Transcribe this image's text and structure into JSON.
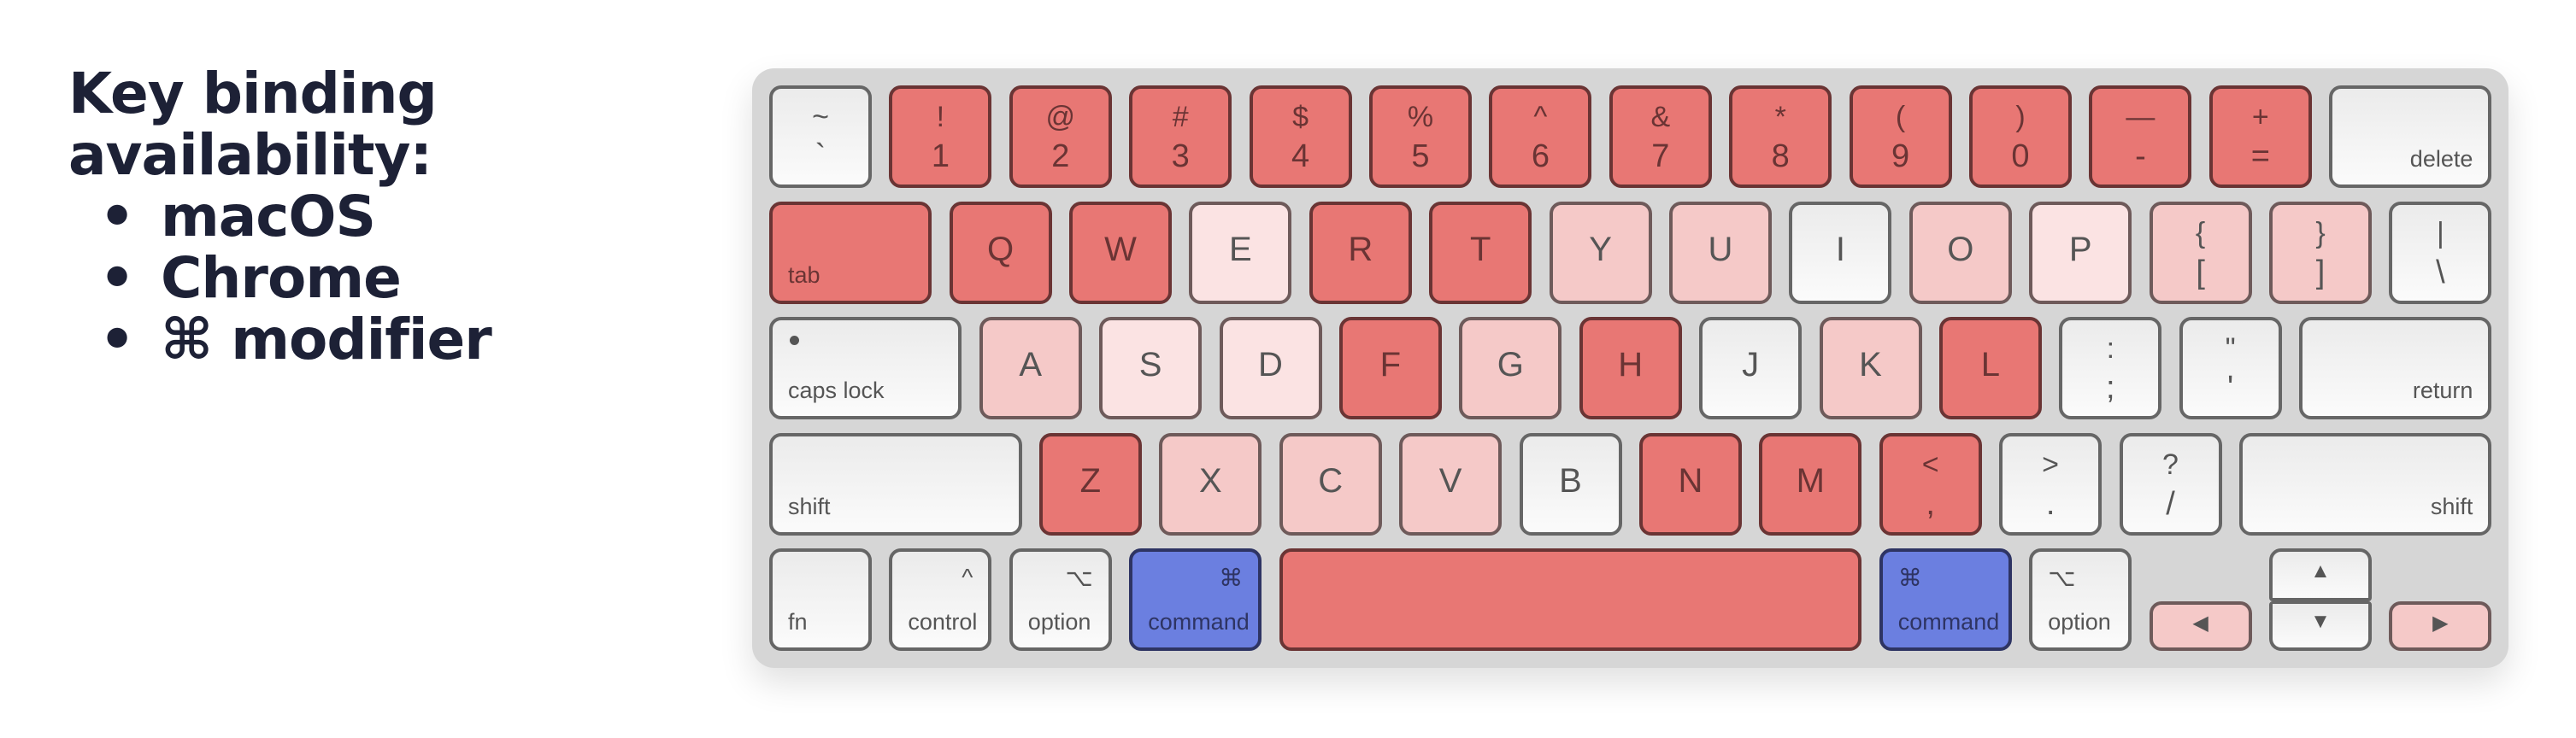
{
  "title": {
    "heading_line1": "Key binding",
    "heading_line2": "availability:",
    "bullet_glyph": "•",
    "items": [
      "macOS",
      "Chrome",
      "⌘ modifier"
    ]
  },
  "legend_colors": {
    "unavailable": "#e87774",
    "mostly_unavailable": "#f5c9c8",
    "partly_unavailable": "#fbe3e3",
    "available": "#f5f5f5",
    "modifier": "#6b7fe0"
  },
  "keyboard": {
    "rows": [
      [
        {
          "id": "backtick",
          "top": "~",
          "bottom": "`",
          "shade": "none"
        },
        {
          "id": "1",
          "top": "!",
          "bottom": "1",
          "shade": "full"
        },
        {
          "id": "2",
          "top": "@",
          "bottom": "2",
          "shade": "full"
        },
        {
          "id": "3",
          "top": "#",
          "bottom": "3",
          "shade": "full"
        },
        {
          "id": "4",
          "top": "$",
          "bottom": "4",
          "shade": "full"
        },
        {
          "id": "5",
          "top": "%",
          "bottom": "5",
          "shade": "full"
        },
        {
          "id": "6",
          "top": "^",
          "bottom": "6",
          "shade": "full"
        },
        {
          "id": "7",
          "top": "&",
          "bottom": "7",
          "shade": "full"
        },
        {
          "id": "8",
          "top": "*",
          "bottom": "8",
          "shade": "full"
        },
        {
          "id": "9",
          "top": "(",
          "bottom": "9",
          "shade": "full"
        },
        {
          "id": "0",
          "top": ")",
          "bottom": "0",
          "shade": "full"
        },
        {
          "id": "minus",
          "top": "—",
          "bottom": "-",
          "shade": "full"
        },
        {
          "id": "equals",
          "top": "+",
          "bottom": "=",
          "shade": "full"
        },
        {
          "id": "delete",
          "label": "delete",
          "shade": "none"
        }
      ],
      [
        {
          "id": "tab",
          "label": "tab",
          "shade": "full"
        },
        {
          "id": "q",
          "center": "Q",
          "shade": "full"
        },
        {
          "id": "w",
          "center": "W",
          "shade": "full"
        },
        {
          "id": "e",
          "center": "E",
          "shade": "light"
        },
        {
          "id": "r",
          "center": "R",
          "shade": "full"
        },
        {
          "id": "t",
          "center": "T",
          "shade": "full"
        },
        {
          "id": "y",
          "center": "Y",
          "shade": "med"
        },
        {
          "id": "u",
          "center": "U",
          "shade": "med"
        },
        {
          "id": "i",
          "center": "I",
          "shade": "none"
        },
        {
          "id": "o",
          "center": "O",
          "shade": "med"
        },
        {
          "id": "p",
          "center": "P",
          "shade": "light"
        },
        {
          "id": "lbracket",
          "top": "{",
          "bottom": "[",
          "shade": "med"
        },
        {
          "id": "rbracket",
          "top": "}",
          "bottom": "]",
          "shade": "med"
        },
        {
          "id": "backslash",
          "top": "|",
          "bottom": "\\",
          "shade": "none"
        }
      ],
      [
        {
          "id": "capslock",
          "label": "caps lock",
          "shade": "none"
        },
        {
          "id": "a",
          "center": "A",
          "shade": "med"
        },
        {
          "id": "s",
          "center": "S",
          "shade": "light"
        },
        {
          "id": "d",
          "center": "D",
          "shade": "light"
        },
        {
          "id": "f",
          "center": "F",
          "shade": "full"
        },
        {
          "id": "g",
          "center": "G",
          "shade": "med"
        },
        {
          "id": "h",
          "center": "H",
          "shade": "full"
        },
        {
          "id": "j",
          "center": "J",
          "shade": "none"
        },
        {
          "id": "k",
          "center": "K",
          "shade": "med"
        },
        {
          "id": "l",
          "center": "L",
          "shade": "full"
        },
        {
          "id": "semicolon",
          "top": ":",
          "bottom": ";",
          "shade": "none"
        },
        {
          "id": "quote",
          "top": "\"",
          "bottom": "'",
          "shade": "none"
        },
        {
          "id": "return",
          "label": "return",
          "shade": "none"
        }
      ],
      [
        {
          "id": "lshift",
          "label": "shift",
          "shade": "none"
        },
        {
          "id": "z",
          "center": "Z",
          "shade": "full"
        },
        {
          "id": "x",
          "center": "X",
          "shade": "med"
        },
        {
          "id": "c",
          "center": "C",
          "shade": "med"
        },
        {
          "id": "v",
          "center": "V",
          "shade": "med"
        },
        {
          "id": "b",
          "center": "B",
          "shade": "none"
        },
        {
          "id": "n",
          "center": "N",
          "shade": "full"
        },
        {
          "id": "m",
          "center": "M",
          "shade": "full"
        },
        {
          "id": "comma",
          "top": "<",
          "bottom": ",",
          "shade": "full"
        },
        {
          "id": "period",
          "top": ">",
          "bottom": ".",
          "shade": "none"
        },
        {
          "id": "slash",
          "top": "?",
          "bottom": "/",
          "shade": "none"
        },
        {
          "id": "rshift",
          "label": "shift",
          "shade": "none"
        }
      ],
      [
        {
          "id": "fn",
          "label": "fn",
          "shade": "none"
        },
        {
          "id": "control",
          "label": "control",
          "symbol": "^",
          "shade": "none"
        },
        {
          "id": "loption",
          "label": "option",
          "symbol": "⌥",
          "shade": "none"
        },
        {
          "id": "lcommand",
          "label": "command",
          "symbol": "⌘",
          "shade": "cmd"
        },
        {
          "id": "space",
          "shade": "full"
        },
        {
          "id": "rcommand",
          "label": "command",
          "symbol": "⌘",
          "shade": "cmd"
        },
        {
          "id": "roption",
          "label": "option",
          "symbol": "⌥",
          "shade": "none"
        },
        {
          "id": "left",
          "arrow": "◀",
          "shade": "med"
        },
        {
          "id": "up",
          "arrow": "▲",
          "shade": "none"
        },
        {
          "id": "down",
          "arrow": "▼",
          "shade": "none"
        },
        {
          "id": "right",
          "arrow": "▶",
          "shade": "med"
        }
      ]
    ]
  }
}
